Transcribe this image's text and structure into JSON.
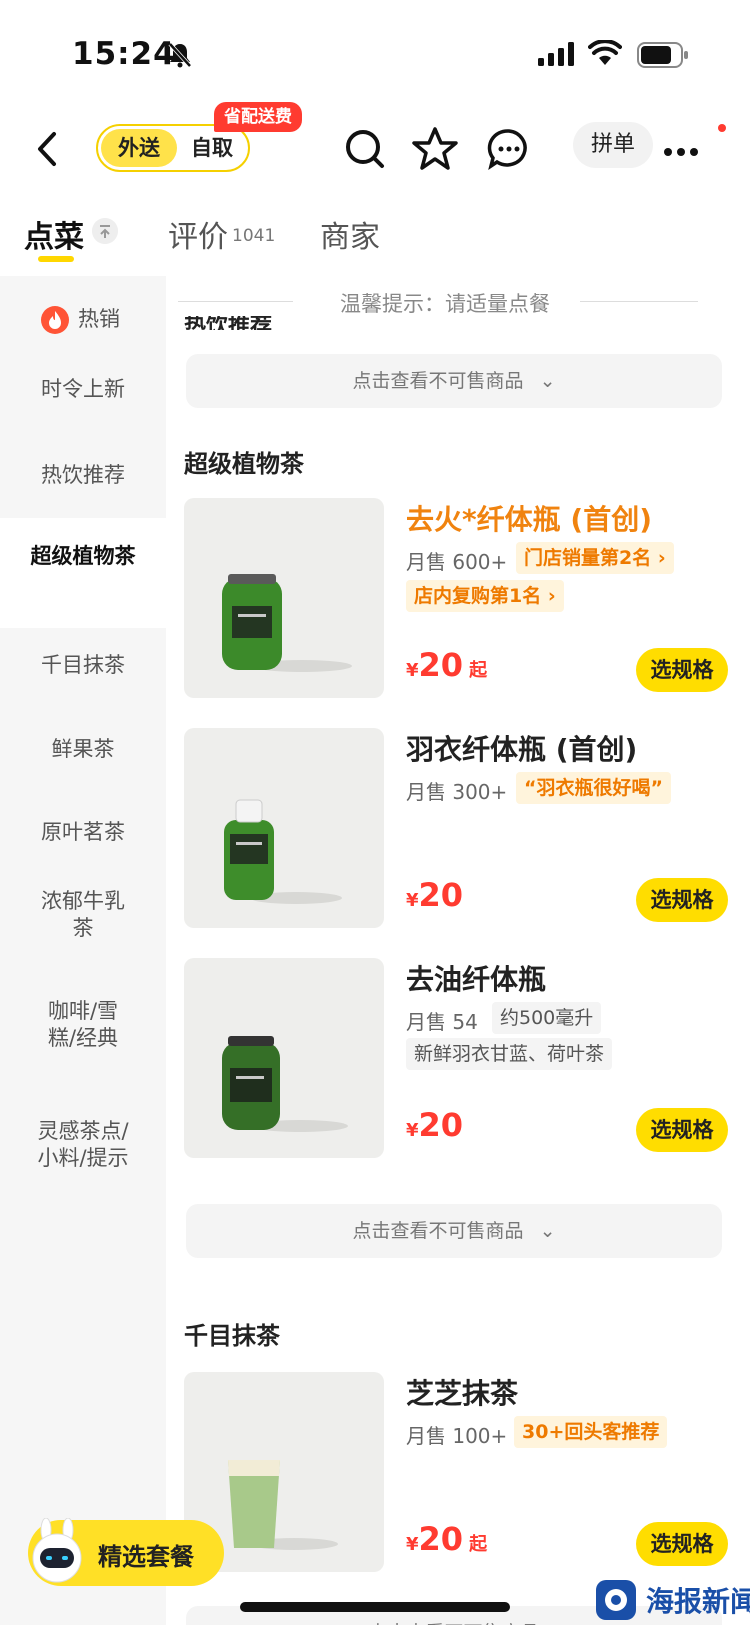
{
  "status_bar": {
    "time": "15:24"
  },
  "nav": {
    "mode_delivery": "外送",
    "mode_pickup": "自取",
    "promo_badge": "省配送费",
    "pindan": "拼单",
    "icons": [
      "back-icon",
      "search-icon",
      "star-icon",
      "chat-icon",
      "more-icon"
    ]
  },
  "tabs": {
    "menu": "点菜",
    "reviews": "评价",
    "reviews_count": "1041",
    "merchant": "商家"
  },
  "sidebar": {
    "items": [
      {
        "label": "热销",
        "icon": "flame-icon"
      },
      {
        "label": "时令上新"
      },
      {
        "label": "热饮推荐"
      },
      {
        "label": "超级植物茶",
        "active": true
      },
      {
        "label": "千目抹茶"
      },
      {
        "label": "鲜果茶"
      },
      {
        "label": "原叶茗茶"
      },
      {
        "label": "浓郁牛乳茶"
      },
      {
        "label": "咖啡/雪糕/经典"
      },
      {
        "label": "灵感茶点/小料/提示"
      }
    ]
  },
  "content": {
    "tip": "温馨提示：请适量点餐",
    "cut_heading": "热饮推荐",
    "unavailable_label": "点击查看不可售商品",
    "sections": [
      {
        "title": "超级植物茶",
        "products": [
          {
            "name": "去火*纤体瓶 (首创)",
            "sales": "月售 600+",
            "tags": [
              "门店销量第2名 ›",
              "店内复购第1名 ›"
            ],
            "currency": "¥",
            "price": "20",
            "price_suffix": "起",
            "button": "选规格"
          },
          {
            "name": "羽衣纤体瓶 (首创)",
            "sales": "月售 300+",
            "tags": [
              "“羽衣瓶很好喝”"
            ],
            "currency": "¥",
            "price": "20",
            "button": "选规格"
          },
          {
            "name": "去油纤体瓶",
            "sales": "月售 54",
            "tags": [
              "约500毫升",
              "新鲜羽衣甘蓝、荷叶茶"
            ],
            "currency": "¥",
            "price": "20",
            "button": "选规格"
          }
        ]
      },
      {
        "title": "千目抹茶",
        "products": [
          {
            "name": "芝芝抹茶",
            "sales": "月售 100+",
            "tags": [
              "30+回头客推荐"
            ],
            "currency": "¥",
            "price": "20",
            "price_suffix": "起",
            "button": "选规格"
          }
        ]
      }
    ]
  },
  "combo_button": "精选套餐",
  "watermark": "海报新闻",
  "colors": {
    "accent_yellow": "#ffdd00",
    "price_red": "#ff3b30",
    "tag_orange": "#ee7a00"
  }
}
